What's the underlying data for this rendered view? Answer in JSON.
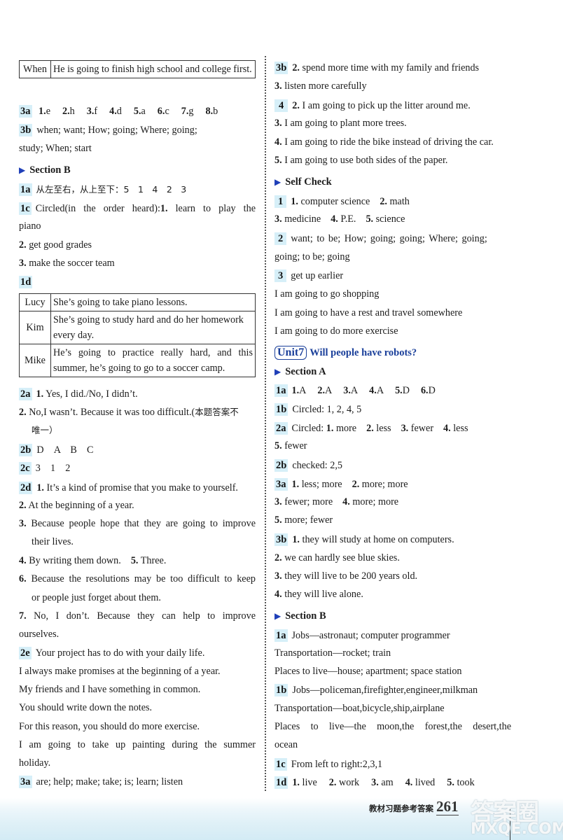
{
  "left": {
    "table_when": {
      "name": "When",
      "text": "He is going to finish high school and college first."
    },
    "ex3a": {
      "label": "3a",
      "items": [
        {
          "n": "1.",
          "v": "e"
        },
        {
          "n": "2.",
          "v": "h"
        },
        {
          "n": "3.",
          "v": "f"
        },
        {
          "n": "4.",
          "v": "d"
        },
        {
          "n": "5.",
          "v": "a"
        },
        {
          "n": "6.",
          "v": "c"
        },
        {
          "n": "7.",
          "v": "g"
        },
        {
          "n": "8.",
          "v": "b"
        }
      ]
    },
    "ex3b": {
      "label": "3b",
      "line1": "when; want; How; going; Where; going;",
      "line2": "study; When; start"
    },
    "section_b": "Section B",
    "ex1a": {
      "label": "1a",
      "text": "从左至右，从上至下：5　1　4　2　3"
    },
    "ex1c": {
      "label": "1c",
      "line1_pre": "Circled(in the order heard):",
      "line1_n": "1.",
      "line1_post": " learn to play the",
      "line2": "piano",
      "item2_n": "2.",
      "item2": " get good grades",
      "item3_n": "3.",
      "item3": " make the soccer team"
    },
    "ex1d": {
      "label": "1d",
      "rows": [
        {
          "name": "Lucy",
          "text": "She’s going to take piano lessons."
        },
        {
          "name": "Kim",
          "text": "She’s going to study hard and do her homework every day."
        },
        {
          "name": "Mike",
          "text": "He’s going to practice really hard, and this summer, he’s going to go to a soccer camp."
        }
      ]
    },
    "ex2a": {
      "label": "2a",
      "i1_n": "1.",
      "i1": " Yes, I did./No, I didn’t.",
      "i2_n": "2.",
      "i2": " No,I wasn’t. Because it was too difficult.(",
      "i2_cn": "本题答案不",
      "i2_cont": "唯一）"
    },
    "ex2b": {
      "label": "2b",
      "text": "D　A　B　C"
    },
    "ex2c": {
      "label": "2c",
      "text": "3　1　2"
    },
    "ex2d": {
      "label": "2d",
      "i1_n": "1.",
      "i1": " It’s a kind of promise that you make to yourself.",
      "i2_n": "2.",
      "i2": " At the beginning of a year.",
      "i3_n": "3.",
      "i3": " Because people hope that they are going to improve",
      "i3b": "their lives.",
      "i4_n": "4.",
      "i4": " By writing them down.",
      "i5_n": "5.",
      "i5": " Three.",
      "i6_n": "6.",
      "i6": " Because the resolutions may be too difficult to keep",
      "i6b": "or people just forget about them.",
      "i7_n": "7.",
      "i7": " No, I don’t. Because they can help to improve",
      "i7b": "ourselves."
    },
    "ex2e": {
      "label": "2e",
      "lines": [
        "Your project has to do with your daily life.",
        "I always make promises at the beginning of a year.",
        "My friends and I have something in common.",
        "You should write down the notes.",
        "For this reason, you should do more exercise.",
        "I am going to take up painting during the summer",
        "holiday."
      ]
    },
    "ex3a_b": {
      "label": "3a",
      "text": "are; help; make; take; is; learn; listen"
    }
  },
  "right": {
    "ex3b": {
      "label": "3b",
      "i2_n": "2.",
      "i2": " spend more time with my family and friends",
      "i3_n": "3.",
      "i3": " listen more carefully"
    },
    "ex4": {
      "label": "4",
      "items": [
        {
          "n": "2.",
          "t": " I am going to pick up the litter around me."
        },
        {
          "n": "3.",
          "t": " I am going to plant more trees."
        },
        {
          "n": "4.",
          "t": " I am going to ride the bike instead of driving the car."
        },
        {
          "n": "5.",
          "t": " I am going to use both sides of the paper."
        }
      ]
    },
    "self_check": "Self Check",
    "sc1": {
      "label": "1",
      "i1_n": "1.",
      "i1": " computer science",
      "i2_n": "2.",
      "i2": " math",
      "i3_n": "3.",
      "i3": " medicine",
      "i4_n": "4.",
      "i4": " P.E.",
      "i5_n": "5.",
      "i5": " science"
    },
    "sc2": {
      "label": "2",
      "line1": "want; to be; How; going; going; Where; going;",
      "line2": "going; to be; going"
    },
    "sc3": {
      "label": "3",
      "line1": "get up earlier",
      "lines": [
        "I am going to go shopping",
        "I am going to have a rest and travel somewhere",
        "I am going to do more exercise"
      ]
    },
    "unit": {
      "badge": "Unit7",
      "title": "Will people have robots?"
    },
    "section_a": "Section A",
    "a1a": {
      "label": "1a",
      "items": [
        {
          "n": "1.",
          "v": "A"
        },
        {
          "n": "2.",
          "v": "A"
        },
        {
          "n": "3.",
          "v": "A"
        },
        {
          "n": "4.",
          "v": "A"
        },
        {
          "n": "5.",
          "v": "D"
        },
        {
          "n": "6.",
          "v": "D"
        }
      ]
    },
    "a1b": {
      "label": "1b",
      "text": "Circled: 1, 2, 4, 5"
    },
    "a2a": {
      "label": "2a",
      "pre": "Circled: ",
      "i1_n": "1.",
      "i1": " more",
      "i2_n": "2.",
      "i2": " less",
      "i3_n": "3.",
      "i3": " fewer",
      "i4_n": "4.",
      "i4": " less",
      "i5_n": "5.",
      "i5": " fewer"
    },
    "a2b": {
      "label": "2b",
      "text": "checked: 2,5"
    },
    "a3a": {
      "label": "3a",
      "i1_n": "1.",
      "i1": " less; more",
      "i2_n": "2.",
      "i2": " more; more",
      "i3_n": "3.",
      "i3": " fewer; more",
      "i4_n": "4.",
      "i4": " more; more",
      "i5_n": "5.",
      "i5": " more; fewer"
    },
    "a3b": {
      "label": "3b",
      "i1_n": "1.",
      "i1": " they will study at home on computers.",
      "i2_n": "2.",
      "i2": " we can hardly see blue skies.",
      "i3_n": "3.",
      "i3": " they will live to be 200 years old.",
      "i4_n": "4.",
      "i4": " they will live alone."
    },
    "section_b": "Section B",
    "b1a": {
      "label": "1a",
      "line1": "Jobs—astronaut; computer programmer",
      "line2": "Transportation—rocket; train",
      "line3": "Places to live—house; apartment; space station"
    },
    "b1b": {
      "label": "1b",
      "line1": "Jobs—policeman,firefighter,engineer,milkman",
      "line2": "Transportation—boat,bicycle,ship,airplane",
      "line3": "Places to live—the moon,the forest,the desert,the",
      "line4": "ocean"
    },
    "b1c": {
      "label": "1c",
      "text": "From left to right:2,3,1"
    },
    "b1d": {
      "label": "1d",
      "items": [
        {
          "n": "1.",
          "v": " live"
        },
        {
          "n": "2.",
          "v": " work"
        },
        {
          "n": "3.",
          "v": " am"
        },
        {
          "n": "4.",
          "v": " lived"
        },
        {
          "n": "5.",
          "v": " took"
        }
      ]
    }
  },
  "footer": {
    "caption": "教材习题参考答案",
    "page_number": "261"
  },
  "watermark": {
    "top": "答案圈",
    "bottom": "MXQE.COM"
  },
  "colors": {
    "label_highlight": "#d6eff8",
    "accent_blue": "#1a3f9a",
    "triangle_blue": "#1f3fb8"
  }
}
